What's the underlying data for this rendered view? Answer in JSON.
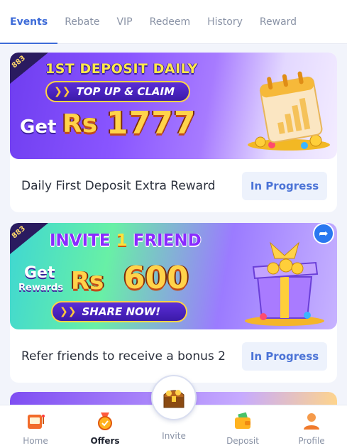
{
  "tabs": [
    {
      "label": "Events",
      "active": true
    },
    {
      "label": "Rebate"
    },
    {
      "label": "VIP"
    },
    {
      "label": "Redeem"
    },
    {
      "label": "History"
    },
    {
      "label": "Reward"
    }
  ],
  "brand_badge": "883",
  "cards": [
    {
      "banner": {
        "headline": "1ST DEPOSIT DAILY",
        "button": "TOP UP & CLAIM",
        "get": "Get",
        "currency": "Rs",
        "amount": "1777"
      },
      "title": "Daily First Deposit Extra Reward",
      "status": "In Progress"
    },
    {
      "banner": {
        "headline_pre": "INVITE",
        "headline_num": "1",
        "headline_post": "FRIEND",
        "get": "Get",
        "rewards": "Rewards",
        "currency": "Rs",
        "amount": "600",
        "button": "SHARE NOW!"
      },
      "title": "Refer friends to receive a bonus 2",
      "status": "In Progress"
    }
  ],
  "nav": [
    {
      "label": "Home",
      "icon": "slot-machine-icon"
    },
    {
      "label": "Offers",
      "icon": "medal-icon",
      "active": true
    },
    {
      "label": "Invite",
      "icon": "treasure-chest-icon"
    },
    {
      "label": "Deposit",
      "icon": "wallet-icon"
    },
    {
      "label": "Profile",
      "icon": "user-icon"
    }
  ],
  "colors": {
    "accent": "#3d6bd8",
    "status_bg": "#edf2fc",
    "status_text": "#4b73d6"
  }
}
